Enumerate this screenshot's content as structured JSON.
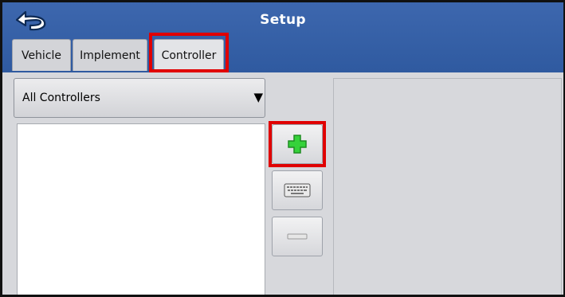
{
  "header": {
    "title": "Setup"
  },
  "tabs": [
    {
      "label": "Vehicle"
    },
    {
      "label": "Implement"
    },
    {
      "label": "Controller"
    }
  ],
  "controller_filter": {
    "selected": "All Controllers"
  },
  "icons": {
    "back": "back-arrow-icon",
    "add": "plus-icon",
    "keyboard": "keyboard-icon",
    "remove": "minus-icon",
    "dropdown": "triangle-down-icon"
  },
  "colors": {
    "header": "#3561a8",
    "highlight": "#e00000",
    "add_icon": "#2ecc2e"
  }
}
